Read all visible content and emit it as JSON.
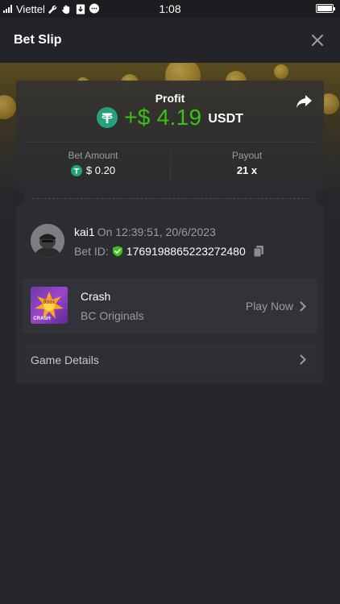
{
  "status_bar": {
    "carrier": "Viettel",
    "time": "1:08"
  },
  "header": {
    "title": "Bet Slip"
  },
  "profit": {
    "label": "Profit",
    "value": "+$ 4.19",
    "currency": "USDT"
  },
  "stats": {
    "bet_amount_label": "Bet Amount",
    "bet_amount_value": "$ 0.20",
    "payout_label": "Payout",
    "payout_value": "21 x"
  },
  "bet": {
    "username": "kai1",
    "time": "On 12:39:51, 20/6/2023",
    "bet_id_label": "Bet ID:",
    "bet_id": "1769198865223272480"
  },
  "game": {
    "name": "Crash",
    "provider": "BC Originals",
    "play_label": "Play Now",
    "thumb_text": "CRASH",
    "thumb_badge": "999x"
  },
  "details": {
    "label": "Game Details"
  },
  "colors": {
    "profit_green": "#3bc117",
    "usdt_teal": "#26a17b",
    "shield_green": "#3bc117",
    "background": "#26272b"
  },
  "icons": [
    "signal-icon",
    "wrench-icon",
    "hand-icon",
    "download-icon",
    "chat-icon",
    "battery-icon",
    "close-icon",
    "usdt-icon",
    "share-icon",
    "shield-check-icon",
    "copy-icon",
    "chevron-right-icon"
  ]
}
